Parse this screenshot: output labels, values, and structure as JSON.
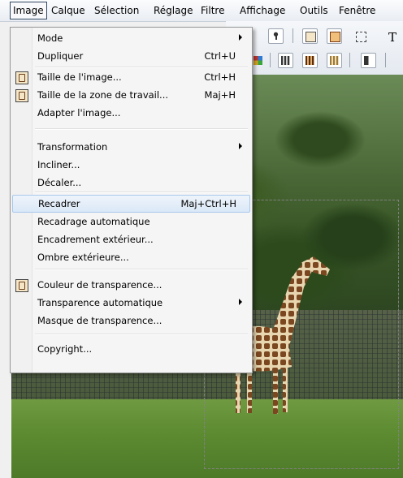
{
  "menubar": {
    "items": [
      "Image",
      "Calque",
      "Sélection",
      "Réglage",
      "Filtre",
      "Affichage",
      "Outils",
      "Fenêtre"
    ],
    "open_index": 0
  },
  "toolbar": {
    "trailing_text": "T"
  },
  "image_menu": {
    "items": [
      {
        "label": "Mode",
        "shortcut": "",
        "submenu": true
      },
      {
        "label": "Dupliquer",
        "shortcut": "Ctrl+U"
      },
      {
        "label": "Taille de l'image...",
        "shortcut": "Ctrl+H",
        "icon": "image-size-icon"
      },
      {
        "label": "Taille de la zone de travail...",
        "shortcut": "Maj+H",
        "icon": "canvas-size-icon"
      },
      {
        "label": "Adapter l'image...",
        "shortcut": ""
      },
      {
        "label": "Transformation",
        "shortcut": "",
        "submenu": true
      },
      {
        "label": "Incliner...",
        "shortcut": ""
      },
      {
        "label": "Décaler...",
        "shortcut": ""
      },
      {
        "label": "Recadrer",
        "shortcut": "Maj+Ctrl+H",
        "highlighted": true
      },
      {
        "label": "Recadrage automatique",
        "shortcut": ""
      },
      {
        "label": "Encadrement extérieur...",
        "shortcut": ""
      },
      {
        "label": "Ombre extérieure...",
        "shortcut": ""
      },
      {
        "label": "Couleur de transparence...",
        "shortcut": "",
        "icon": "transparency-color-icon"
      },
      {
        "label": "Transparence automatique",
        "shortcut": "",
        "submenu": true
      },
      {
        "label": "Masque de transparence...",
        "shortcut": ""
      },
      {
        "label": "Copyright...",
        "shortcut": ""
      }
    ]
  },
  "colors": {
    "highlight_bg": "#dbe8f7",
    "highlight_border": "#a8c8ec",
    "menu_bg": "#f5f5f5"
  }
}
